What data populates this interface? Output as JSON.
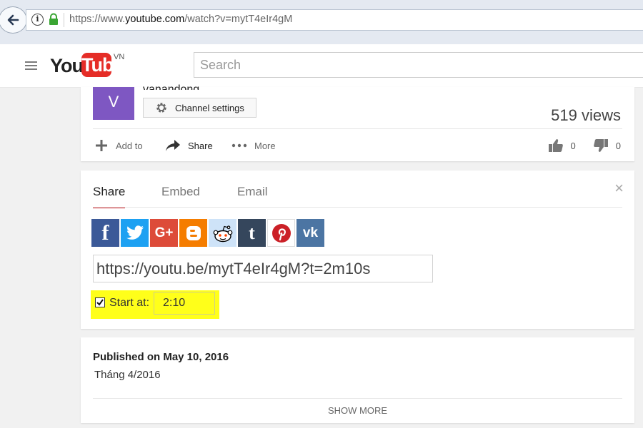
{
  "browser": {
    "url_prefix": "https://www.",
    "url_domain": "youtube.com",
    "url_path": "/watch?v=mytT4eIr4gM"
  },
  "header": {
    "logo_you": "You",
    "logo_tube": "Tube",
    "logo_region": "VN",
    "search_placeholder": "Search"
  },
  "channel": {
    "avatar_letter": "V",
    "name": "vanandong",
    "settings_label": "Channel settings",
    "views": "519 views",
    "avatar_color": "#7e57c2"
  },
  "actions": {
    "add_label": "Add to",
    "share_label": "Share",
    "more_label": "More",
    "likes": "0",
    "dislikes": "0"
  },
  "share_panel": {
    "tabs": [
      "Share",
      "Embed",
      "Email"
    ],
    "close_glyph": "×",
    "socials": [
      {
        "name": "facebook",
        "glyph": "f",
        "color": "#3b5998"
      },
      {
        "name": "twitter",
        "glyph": "t",
        "color": "#1da1f2"
      },
      {
        "name": "google-plus",
        "glyph": "G+",
        "color": "#dd4b39"
      },
      {
        "name": "blogger",
        "glyph": "B",
        "color": "#f57d00"
      },
      {
        "name": "reddit",
        "glyph": "r",
        "color": "#cee3f8"
      },
      {
        "name": "tumblr",
        "glyph": "t",
        "color": "#35465c"
      },
      {
        "name": "pinterest",
        "glyph": "P",
        "color": "#cb2027"
      },
      {
        "name": "vk",
        "glyph": "vk",
        "color": "#4c75a3"
      }
    ],
    "share_url": "https://youtu.be/mytT4eIr4gM?t=2m10s",
    "start_at_label": "Start at:",
    "start_at_checked": true,
    "start_time": "2:10",
    "highlight_color": "#ffff1a"
  },
  "description": {
    "published": "Published on May 10, 2016",
    "text": "Tháng 4/2016",
    "show_more": "SHOW MORE"
  }
}
